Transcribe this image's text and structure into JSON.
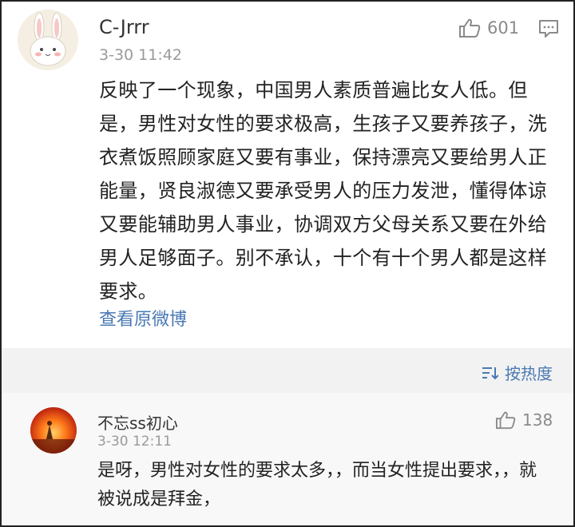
{
  "main_comment": {
    "username": "C-Jrrr",
    "timestamp": "3-30 11:42",
    "likes": "601",
    "text": "反映了一个现象，中国男人素质普遍比女人低。但是，男性对女性的要求极高，生孩子又要养孩子，洗衣煮饭照顾家庭又要有事业，保持漂亮又要给男人正能量，贤良淑德又要承受男人的压力发泄，懂得体谅又要能辅助男人事业，协调双方父母关系又要在外给男人足够面子。别不承认，十个有十个男人都是这样要求。",
    "view_original": "查看原微博"
  },
  "sort": {
    "label": "按热度"
  },
  "reply": {
    "username": "不忘ss初心",
    "timestamp": "3-30 12:11",
    "likes": "138",
    "text": "是呀，男性对女性的要求太多，，而当女性提出要求，，就被说成是拜金，"
  },
  "colors": {
    "link": "#4a79b3",
    "meta": "#9a9a9a",
    "band": "#f2f2f2"
  },
  "icons": {
    "like": "thumbs-up-icon",
    "comment": "comment-icon",
    "sort": "sort-lines-icon"
  }
}
